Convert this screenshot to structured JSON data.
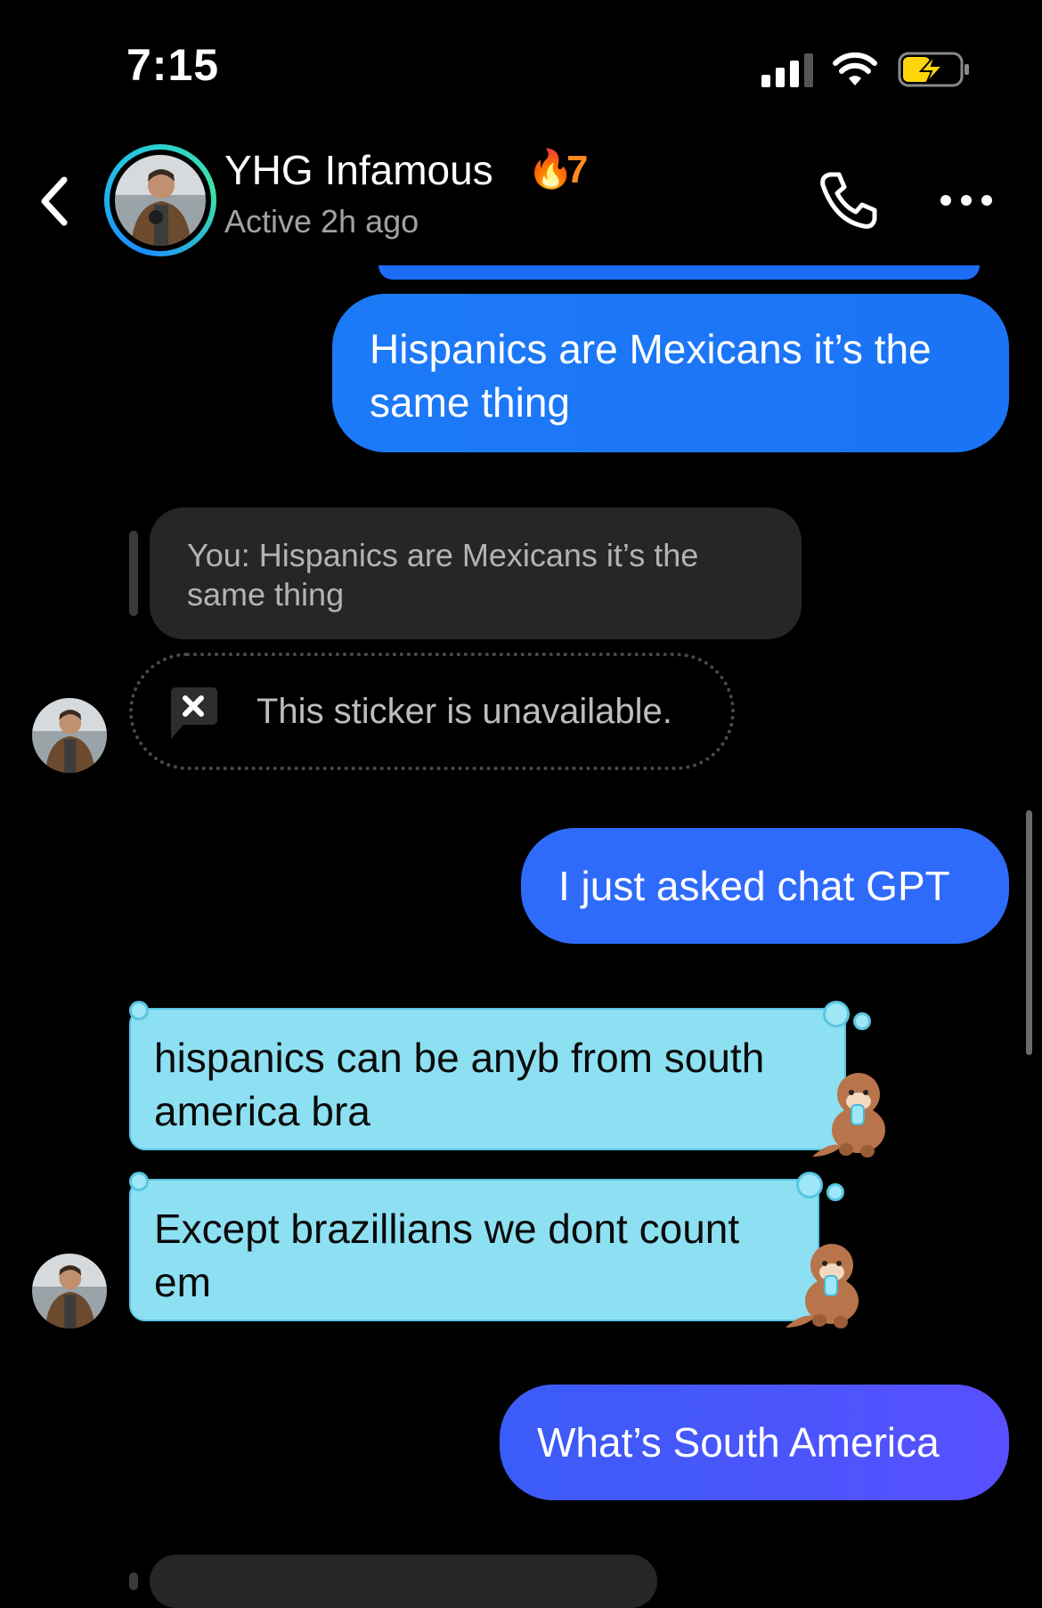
{
  "status_bar": {
    "time": "7:15"
  },
  "header": {
    "contact_name": "YHG Infamous",
    "streak_emoji": "🔥",
    "streak_count": "7",
    "status": "Active 2h ago"
  },
  "messages": {
    "out_1": "Hispanics are Mexicans it’s the same thing",
    "reply_preview": "You: Hispanics are Mexicans it’s the same thing",
    "sticker_unavailable": "This sticker is unavailable.",
    "out_2": "I just asked chat GPT",
    "in_1": "hispanics can be anyb from south america bra",
    "in_2": "Except brazillians we dont count em",
    "out_3": "What’s South America"
  },
  "colors": {
    "outgoing_start": "#1c7af7",
    "outgoing_end": "#5850ff",
    "incoming_bubble": "#8de0f2",
    "streak": "#ff8a1e"
  },
  "icons": [
    "back-icon",
    "phone-icon",
    "more-icon",
    "sticker-unavailable-icon",
    "otter-sticker-icon"
  ]
}
